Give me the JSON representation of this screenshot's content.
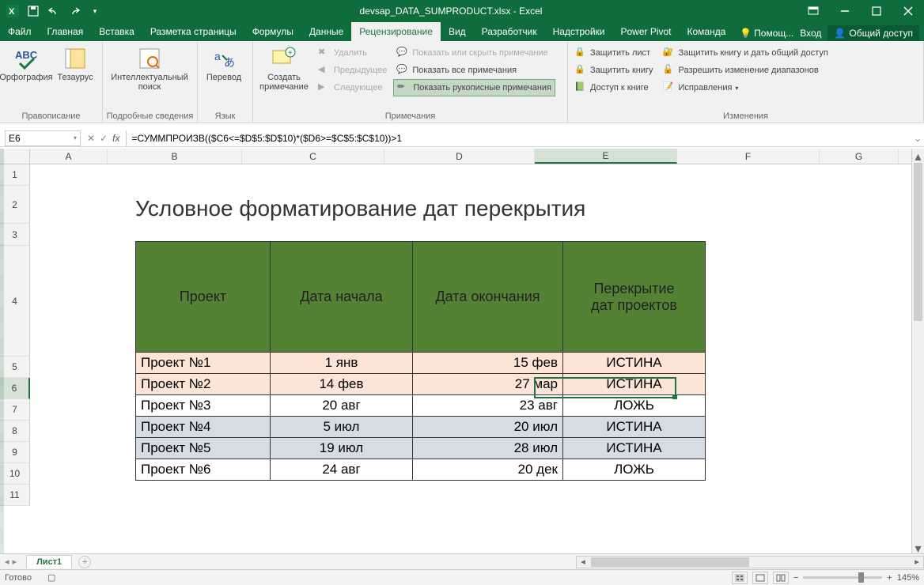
{
  "title": "devsap_DATA_SUMPRODUCT.xlsx - Excel",
  "tabs": [
    "Файл",
    "Главная",
    "Вставка",
    "Разметка страницы",
    "Формулы",
    "Данные",
    "Рецензирование",
    "Вид",
    "Разработчик",
    "Надстройки",
    "Power Pivot",
    "Команда"
  ],
  "active_tab": 6,
  "tell_me": "Помощ...",
  "sign_in": "Вход",
  "share": "Общий доступ",
  "ribbon": {
    "group1_label": "Правописание",
    "spelling": "Орфография",
    "thesaurus": "Тезаурус",
    "group2_label": "Подробные сведения",
    "smart_lookup": "Интеллектуальный\nпоиск",
    "group3_label": "Язык",
    "translate": "Перевод",
    "group4_label": "Примечания",
    "new_comment": "Создать\nпримечание",
    "delete": "Удалить",
    "previous": "Предыдущее",
    "next": "Следующее",
    "show_hide": "Показать или скрыть примечание",
    "show_all": "Показать все примечания",
    "show_ink": "Показать рукописные примечания",
    "group5_label": "Изменения",
    "protect_sheet": "Защитить лист",
    "protect_wb": "Защитить книгу",
    "share_wb": "Доступ к книге",
    "protect_share": "Защитить книгу и дать общий доступ",
    "allow_ranges": "Разрешить изменение диапазонов",
    "track_changes": "Исправления"
  },
  "name_box": "E6",
  "formula": "=СУММПРОИЗВ(($C6<=$D$5:$D$10)*($D6>=$C$5:$C$10))>1",
  "columns": {
    "A": 98,
    "B": 170,
    "C": 180,
    "D": 190,
    "E": 180,
    "F": 180,
    "G": 100
  },
  "row_heights": {
    "1": 27,
    "2": 48,
    "3": 28,
    "4": 140,
    "5": 27,
    "6": 27,
    "7": 27,
    "8": 27,
    "9": 27,
    "10": 27,
    "11": 27
  },
  "sheet_title": "Условное форматирование дат перекрытия",
  "table": {
    "headers": [
      "Проект",
      "Дата начала",
      "Дата окончания",
      "Перекрытие\nдат проектов"
    ],
    "rows": [
      {
        "p": "Проект №1",
        "s": "1 янв",
        "e": "15 фев",
        "o": "ИСТИНА",
        "hl": "pink"
      },
      {
        "p": "Проект №2",
        "s": "14 фев",
        "e": "27 мар",
        "o": "ИСТИНА",
        "hl": "pink"
      },
      {
        "p": "Проект №3",
        "s": "20 авг",
        "e": "23 авг",
        "o": "ЛОЖЬ",
        "hl": ""
      },
      {
        "p": "Проект №4",
        "s": "5 июл",
        "e": "20 июл",
        "o": "ИСТИНА",
        "hl": "blue"
      },
      {
        "p": "Проект №5",
        "s": "19 июл",
        "e": "28 июл",
        "o": "ИСТИНА",
        "hl": "blue"
      },
      {
        "p": "Проект №6",
        "s": "24 авг",
        "e": "20 дек",
        "o": "ЛОЖЬ",
        "hl": ""
      }
    ]
  },
  "sheet_tab": "Лист1",
  "status": "Готово",
  "zoom": "145%"
}
